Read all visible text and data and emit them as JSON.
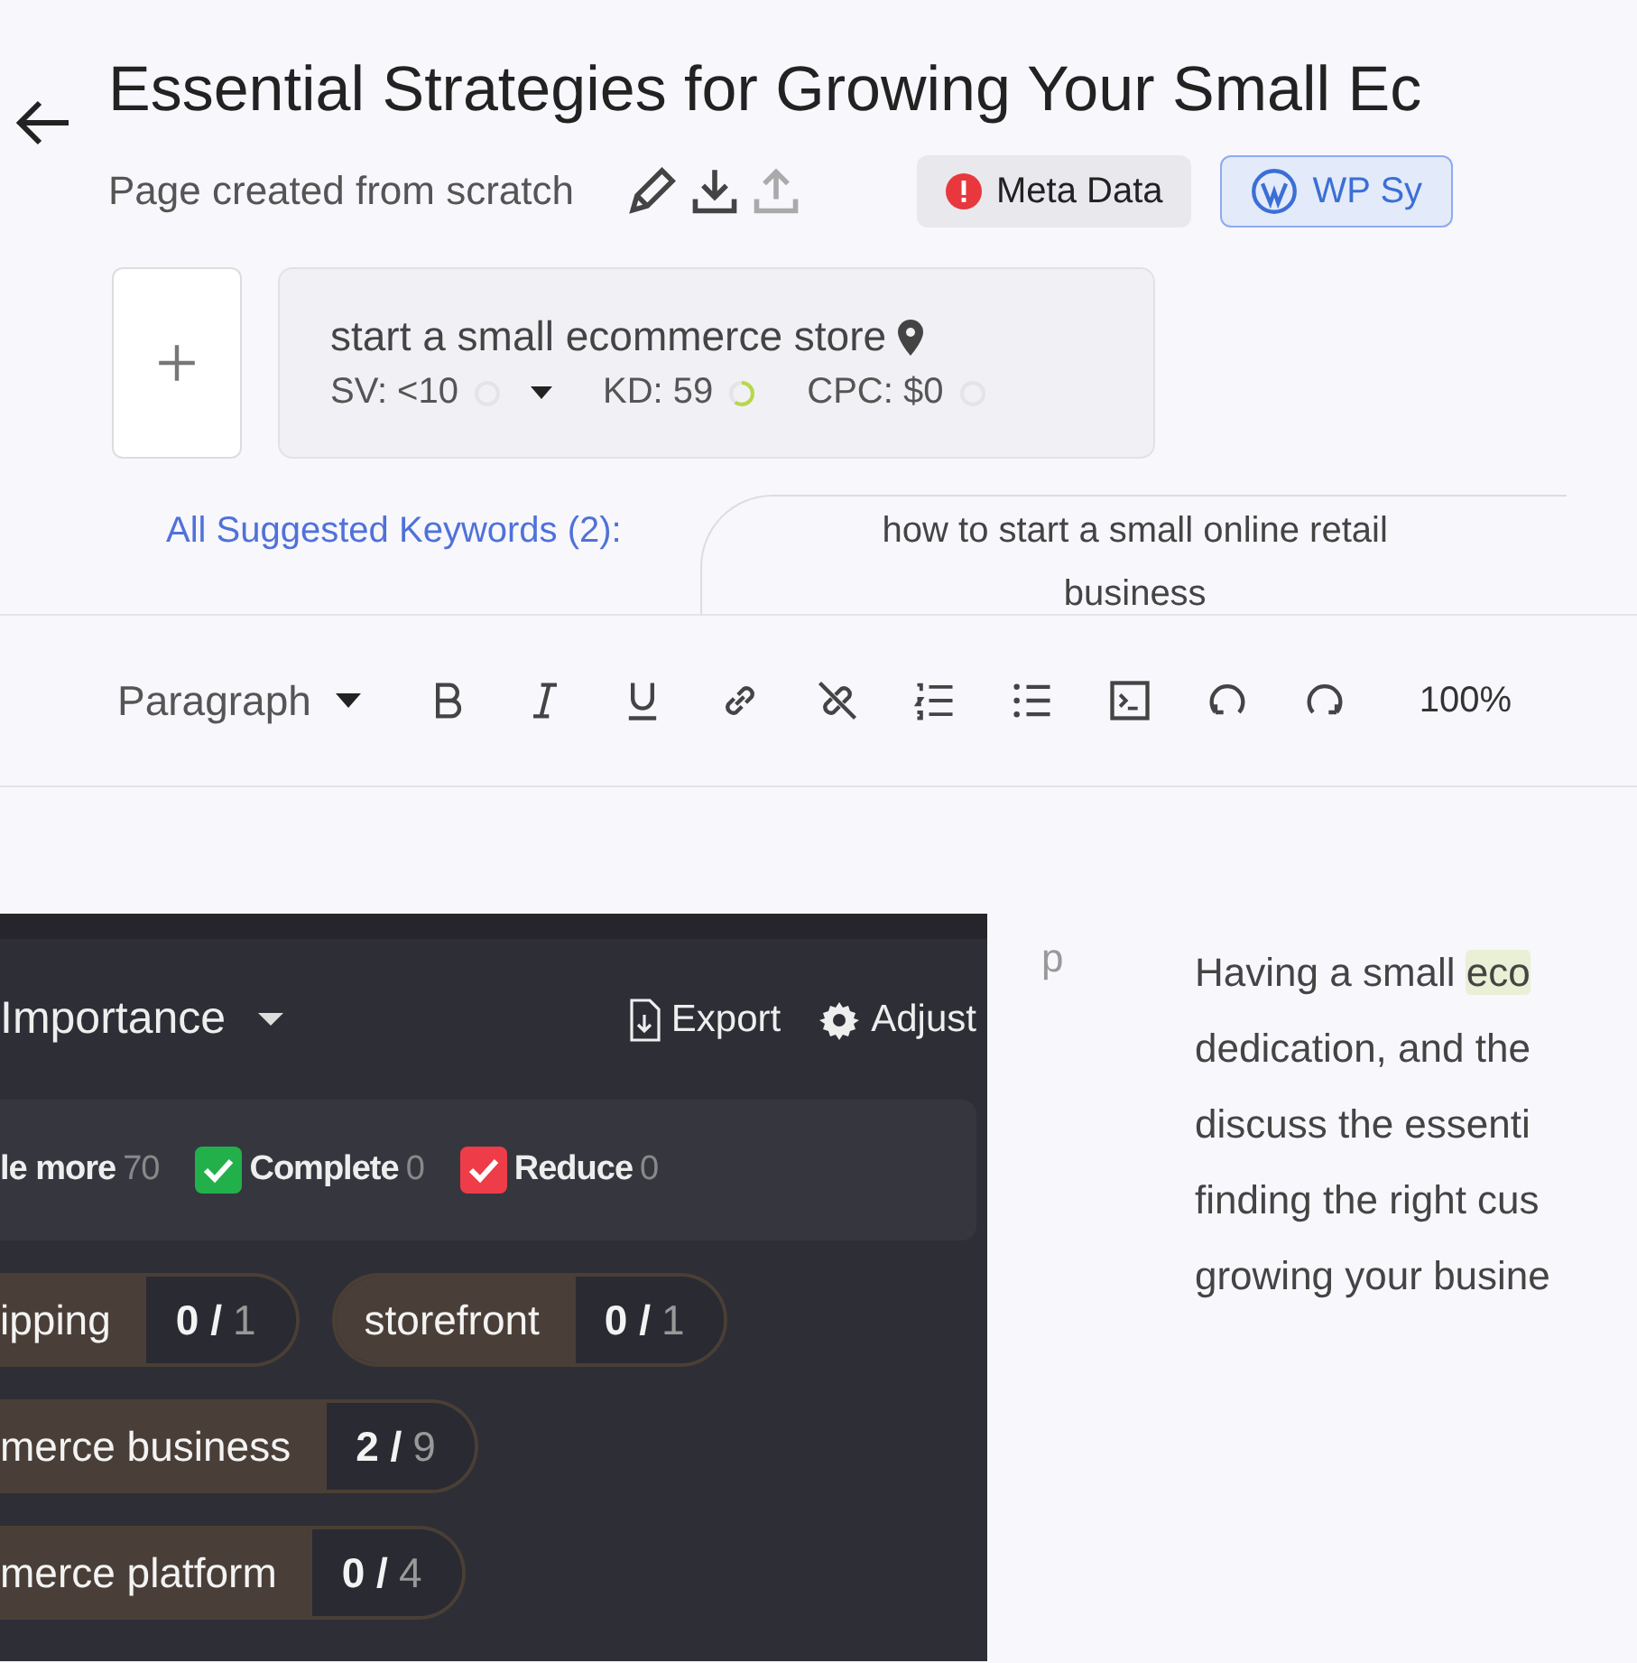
{
  "header": {
    "title": "Essential Strategies for Growing Your Small Ec",
    "subtitle": "Page created from scratch",
    "actions": [
      {
        "kind": "edit",
        "disabled": false
      },
      {
        "kind": "download",
        "disabled": false
      },
      {
        "kind": "upload",
        "disabled": true
      }
    ],
    "buttons": [
      {
        "kind": "meta",
        "label": "Meta Data"
      },
      {
        "kind": "wp",
        "label": "WP Sy"
      }
    ]
  },
  "keyword": {
    "text": "start a small ecommerce store",
    "metrics": [
      {
        "label": "SV: <10",
        "level": 0,
        "dropdown": true
      },
      {
        "label": "KD: 59",
        "level": 0.6,
        "dropdown": false
      },
      {
        "label": "CPC: $0",
        "level": 0,
        "dropdown": false
      }
    ]
  },
  "suggested": {
    "label": "All Suggested Keywords (2):",
    "keywords": [
      "how to start a small online retail business"
    ]
  },
  "toolbar": {
    "block_type": "Paragraph",
    "zoom": "100%"
  },
  "panel": {
    "sort": "Importance",
    "export": "Export",
    "adjust": "Adjust",
    "filters": [
      {
        "label": "le more",
        "count": "70",
        "checkbox": false
      },
      {
        "label": "Complete",
        "count": "0",
        "checkbox": true,
        "checked": true,
        "color": "#22b04b"
      },
      {
        "label": "Reduce",
        "count": "0",
        "checkbox": true,
        "checked": true,
        "color": "#ee3d48"
      }
    ],
    "term_rows": [
      [
        {
          "label": "ipping",
          "done": "0 /",
          "total": "1"
        },
        {
          "label": "storefront",
          "done": "0 /",
          "total": "1"
        }
      ],
      [
        {
          "label": "merce business",
          "done": "2 /",
          "total": "9"
        }
      ],
      [
        {
          "label": "merce platform",
          "done": "0 /",
          "total": "4"
        }
      ]
    ]
  },
  "editor": {
    "block_tag": "p",
    "lines": [
      {
        "text": "Having a small ",
        "highlight": "eco"
      },
      {
        "text": "dedication, and the"
      },
      {
        "text": "discuss the essenti"
      },
      {
        "text": "finding the right cus"
      },
      {
        "text": "growing your busine"
      }
    ]
  }
}
